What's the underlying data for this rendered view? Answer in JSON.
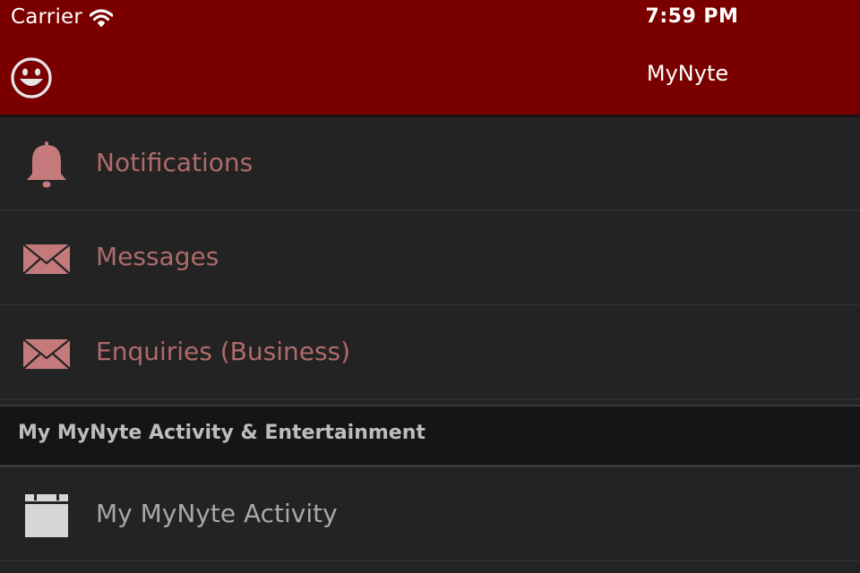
{
  "status_bar": {
    "carrier": "Carrier",
    "time": "7:59 PM",
    "wifi_icon": "wifi-icon"
  },
  "nav_bar": {
    "title": "MyNyte",
    "left_icon": "smiley-icon",
    "background_color": "#7a0000"
  },
  "menu": {
    "items": [
      {
        "label": "Notifications",
        "icon": "bell-icon",
        "color": "#b06a6a"
      },
      {
        "label": "Messages",
        "icon": "envelope-icon",
        "color": "#b06a6a"
      },
      {
        "label": "Enquiries (Business)",
        "icon": "envelope-icon",
        "color": "#b06a6a"
      }
    ]
  },
  "section": {
    "title": "My MyNyte Activity & Entertainment",
    "items": [
      {
        "label": "My MyNyte Activity",
        "icon": "calendar-icon",
        "color": "#a8a8a8"
      }
    ]
  },
  "colors": {
    "background": "#232323",
    "accent_icon": "#c47a7a",
    "section_header_bg": "#151515"
  }
}
